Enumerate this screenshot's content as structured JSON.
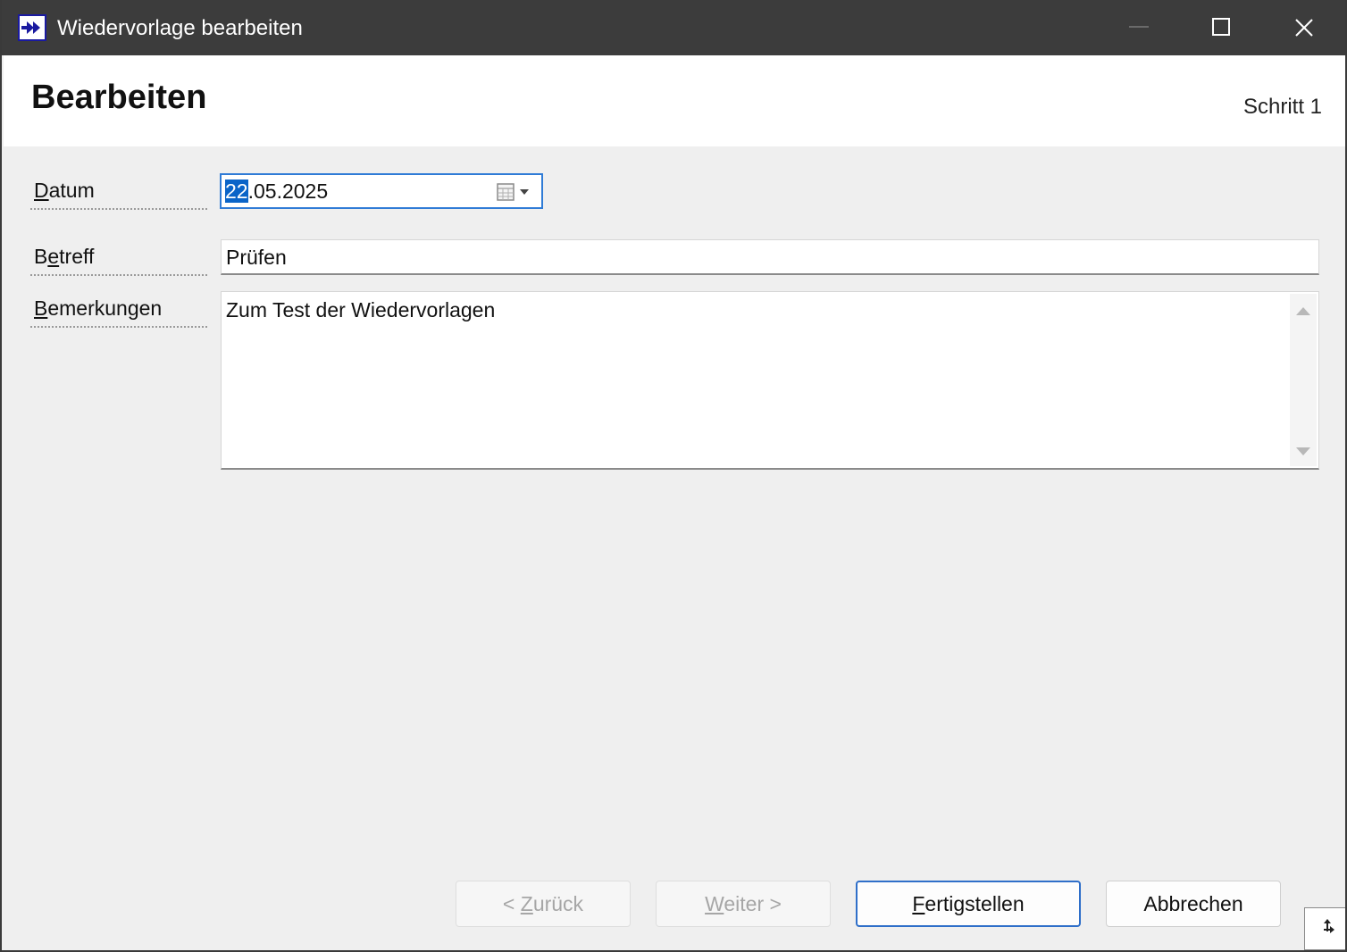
{
  "window": {
    "title": "Wiedervorlage bearbeiten",
    "icon": "forward-arrows-icon",
    "accent_color": "#1a1aa0"
  },
  "header": {
    "title": "Bearbeiten",
    "step": "Schritt 1"
  },
  "form": {
    "date": {
      "label_accel": "D",
      "label_rest": "atum",
      "value_selected": "22",
      "value_rest": ".05.2025"
    },
    "subject": {
      "label_first": "B",
      "label_accel": "e",
      "label_rest": "treff",
      "value": "Prüfen"
    },
    "notes": {
      "label_accel": "B",
      "label_rest": "emerkungen",
      "value": "Zum Test der Wiedervorlagen"
    }
  },
  "buttons": {
    "back": {
      "prefix": "< ",
      "accel": "Z",
      "rest": "urück"
    },
    "next": {
      "accel": "W",
      "rest": "eiter >"
    },
    "finish": {
      "accel": "F",
      "rest": "ertigstellen"
    },
    "cancel": {
      "label": "Abbrechen"
    }
  }
}
